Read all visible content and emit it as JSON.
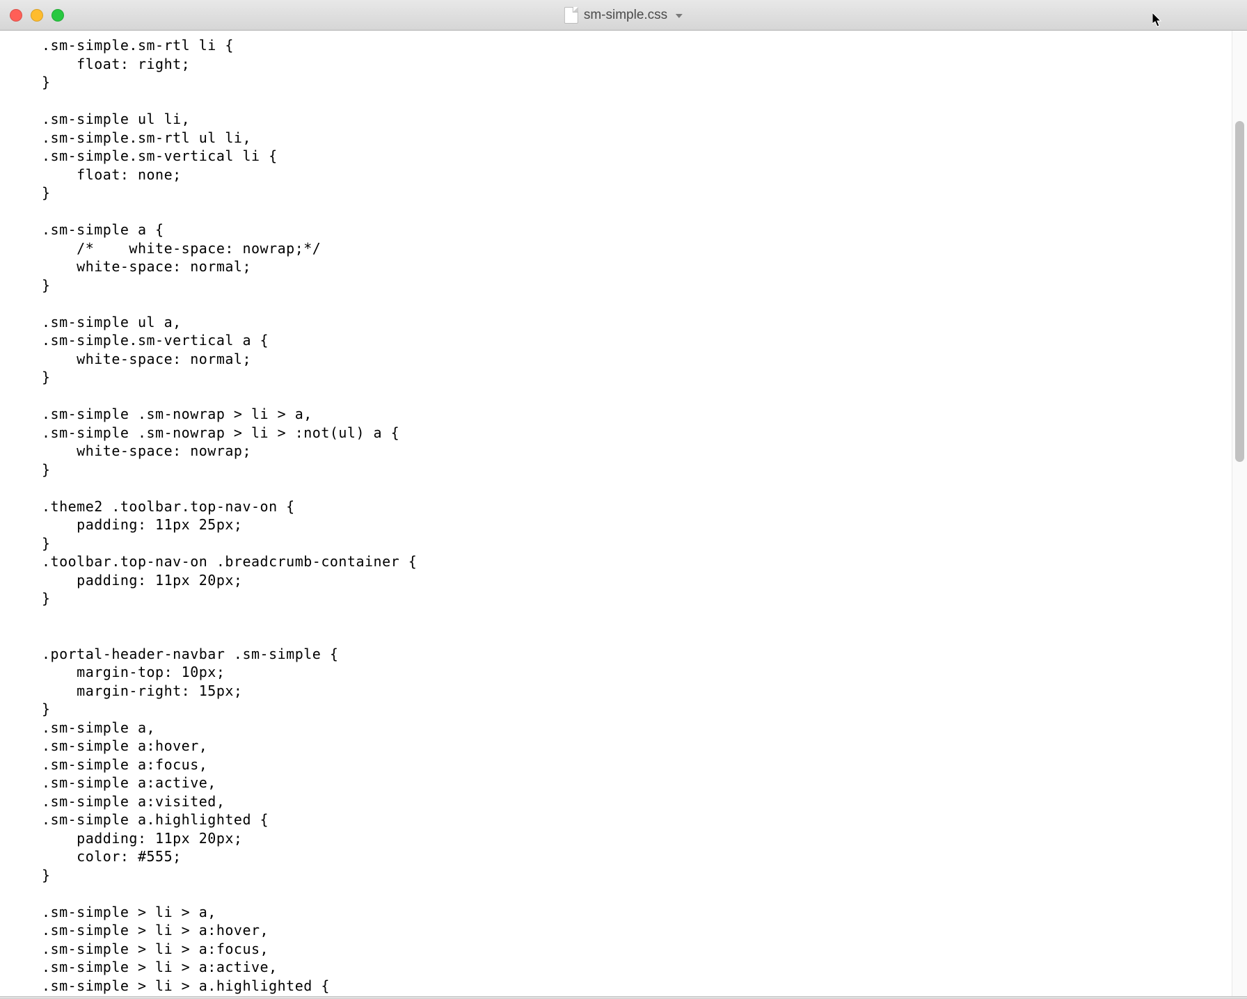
{
  "window": {
    "filename": "sm-simple.css"
  },
  "code": ".sm-simple.sm-rtl li {\n    float: right;\n}\n\n.sm-simple ul li,\n.sm-simple.sm-rtl ul li,\n.sm-simple.sm-vertical li {\n    float: none;\n}\n\n.sm-simple a {\n    /*    white-space: nowrap;*/\n    white-space: normal;\n}\n\n.sm-simple ul a,\n.sm-simple.sm-vertical a {\n    white-space: normal;\n}\n\n.sm-simple .sm-nowrap > li > a,\n.sm-simple .sm-nowrap > li > :not(ul) a {\n    white-space: nowrap;\n}\n\n.theme2 .toolbar.top-nav-on {\n    padding: 11px 25px;\n}\n.toolbar.top-nav-on .breadcrumb-container {\n    padding: 11px 20px;\n}\n\n\n.portal-header-navbar .sm-simple {\n    margin-top: 10px;\n    margin-right: 15px;\n}\n.sm-simple a,\n.sm-simple a:hover,\n.sm-simple a:focus,\n.sm-simple a:active,\n.sm-simple a:visited,\n.sm-simple a.highlighted {\n    padding: 11px 20px;\n    color: #555;\n}\n\n.sm-simple > li > a,\n.sm-simple > li > a:hover,\n.sm-simple > li > a:focus,\n.sm-simple > li > a:active,\n.sm-simple > li > a.highlighted {"
}
